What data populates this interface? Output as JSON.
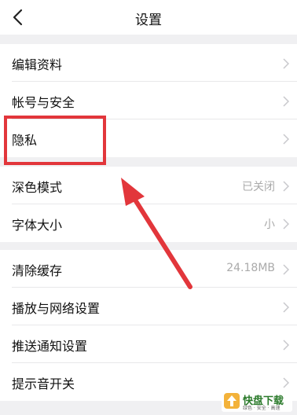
{
  "header": {
    "title": "设置",
    "back_icon": "chevron-left-icon"
  },
  "groups": [
    {
      "items": [
        {
          "label": "编辑资料",
          "value": ""
        },
        {
          "label": "帐号与安全",
          "value": ""
        },
        {
          "label": "隐私",
          "value": ""
        }
      ]
    },
    {
      "items": [
        {
          "label": "深色模式",
          "value": "已关闭"
        },
        {
          "label": "字体大小",
          "value": "小"
        }
      ]
    },
    {
      "items": [
        {
          "label": "清除缓存",
          "value": "24.18MB"
        },
        {
          "label": "播放与网络设置",
          "value": ""
        },
        {
          "label": "推送通知设置",
          "value": ""
        },
        {
          "label": "提示音开关",
          "value": ""
        }
      ]
    }
  ],
  "annotation": {
    "highlight_color": "#e2363b",
    "arrow_color": "#e2363b"
  },
  "watermark": {
    "title": "快盘下载",
    "subtitle": "绿色 · 安全 · 高速"
  },
  "colors": {
    "background": "#f0f0f2",
    "row_background": "#ffffff",
    "secondary_text": "#aaaaaa"
  }
}
